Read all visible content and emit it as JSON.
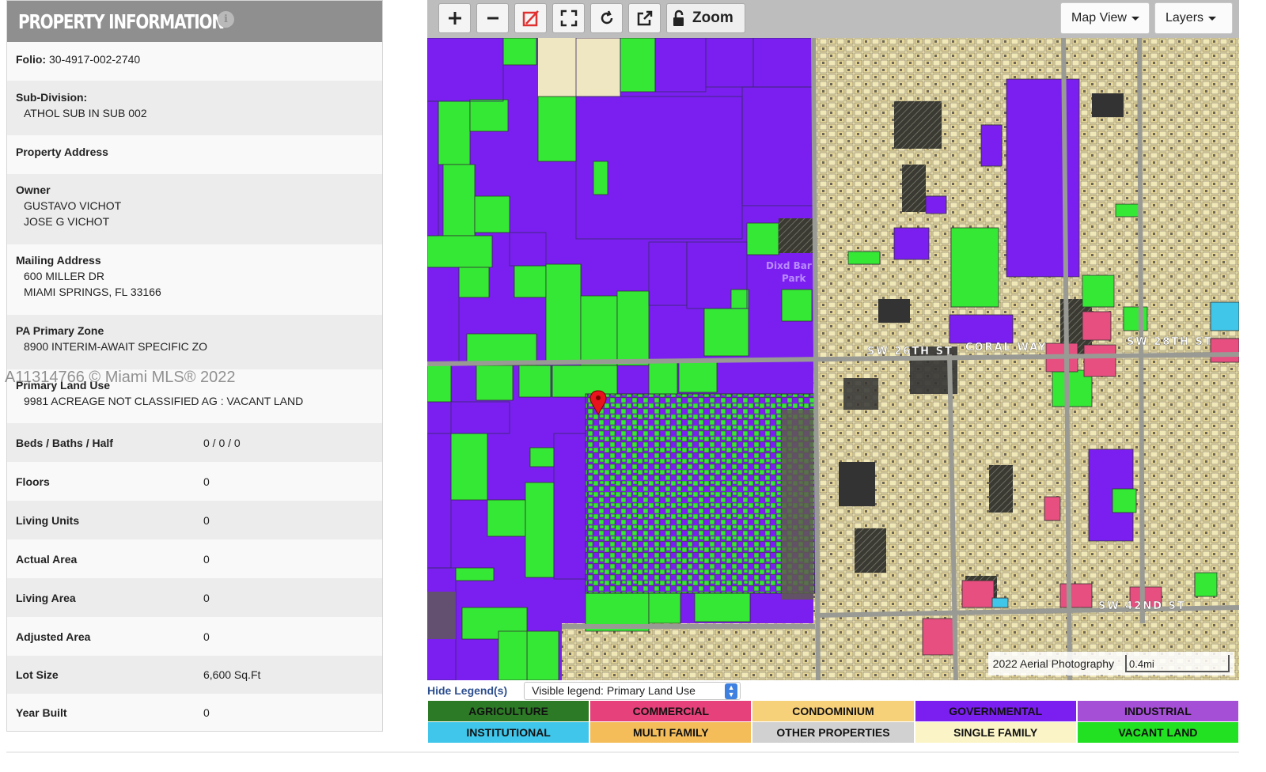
{
  "panel": {
    "title": "PROPERTY INFORMATION",
    "info_icon": "info-icon",
    "folio": {
      "label": "Folio:",
      "value": "30-4917-002-2740"
    },
    "subdivision": {
      "label": "Sub-Division:",
      "value": "ATHOL SUB IN SUB 002"
    },
    "property_address": {
      "label": "Property Address"
    },
    "owner": {
      "label": "Owner",
      "lines": [
        "GUSTAVO VICHOT",
        "JOSE G VICHOT"
      ]
    },
    "mailing": {
      "label": "Mailing Address",
      "lines": [
        "600 MILLER DR",
        "MIAMI SPRINGS, FL 33166"
      ]
    },
    "zone": {
      "label": "PA Primary Zone",
      "value": "8900 INTERIM-AWAIT SPECIFIC ZO"
    },
    "land_use": {
      "label": "Primary Land Use",
      "value": "9981 ACREAGE NOT CLASSIFIED AG : VACANT LAND"
    },
    "details": [
      {
        "label": "Beds / Baths / Half",
        "value": "0 / 0 / 0"
      },
      {
        "label": "Floors",
        "value": "0"
      },
      {
        "label": "Living Units",
        "value": "0"
      },
      {
        "label": "Actual Area",
        "value": "0"
      },
      {
        "label": "Living Area",
        "value": "0"
      },
      {
        "label": "Adjusted Area",
        "value": "0"
      },
      {
        "label": "Lot Size",
        "value": "6,600 Sq.Ft"
      },
      {
        "label": "Year Built",
        "value": "0"
      }
    ]
  },
  "watermark": "A11314766 © Miami MLS® 2022",
  "toolbar": {
    "buttons": [
      "zoom-in-icon",
      "zoom-out-icon",
      "clear-drawing-icon",
      "fullscreen-icon",
      "refresh-icon",
      "share-icon"
    ],
    "zoom_label": "Zoom",
    "map_view_label": "Map View",
    "layers_label": "Layers"
  },
  "map": {
    "aerial_label": "2022 Aerial Photography",
    "scale_label": "0.4mi",
    "street_labels": [
      "SW 26TH ST",
      "CORAL WAY",
      "SW 42ND ST",
      "SW 28TH ST"
    ],
    "marker": "location-pin-icon",
    "colors": {
      "governmental": "#7a1ff0",
      "vacant_land": "#35e835",
      "single_family": "#efe5b0",
      "commercial": "#e64f7f",
      "condominium": "#f5cf78",
      "institutional": "#3fc6e8",
      "road": "#9a9a95",
      "aerial_dark": "#5a5a4e"
    }
  },
  "legend": {
    "hide_label": "Hide Legend(s)",
    "select_value": "Visible legend: Primary Land Use",
    "items": [
      {
        "label": "AGRICULTURE",
        "color": "#2d7a26"
      },
      {
        "label": "COMMERCIAL",
        "color": "#e6417a"
      },
      {
        "label": "CONDOMINIUM",
        "color": "#f7d07a"
      },
      {
        "label": "GOVERNMENTAL",
        "color": "#7a1ff0"
      },
      {
        "label": "INDUSTRIAL",
        "color": "#a54ed6"
      },
      {
        "label": "INSTITUTIONAL",
        "color": "#3fc6ea"
      },
      {
        "label": "MULTI FAMILY",
        "color": "#f4bd5a"
      },
      {
        "label": "OTHER PROPERTIES",
        "color": "#d1d1d1"
      },
      {
        "label": "SINGLE FAMILY",
        "color": "#fbf4c6"
      },
      {
        "label": "VACANT LAND",
        "color": "#22e022"
      }
    ]
  }
}
